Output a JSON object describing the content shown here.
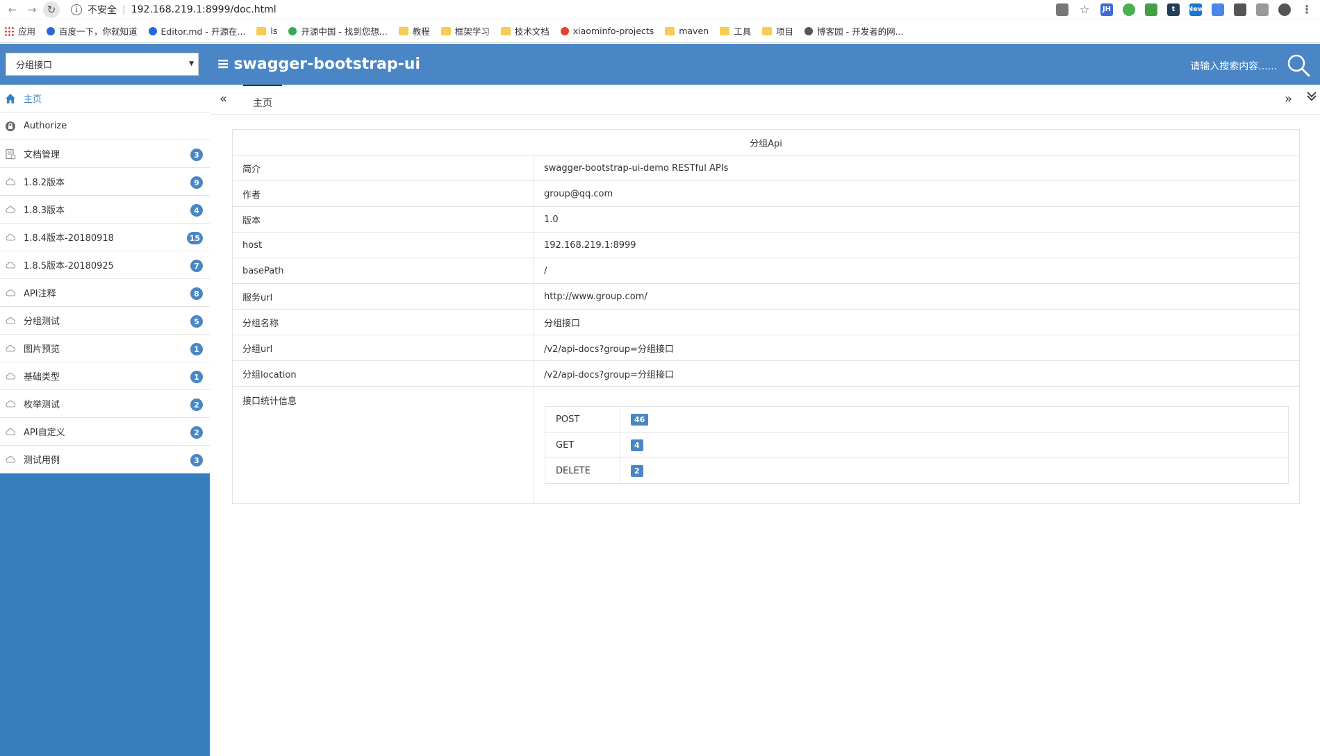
{
  "browser": {
    "insecure_label": "不安全",
    "url": "192.168.219.1:8999/doc.html",
    "extensions": [
      {
        "name": "translate-icon",
        "text": "",
        "color": "#777"
      },
      {
        "name": "star-icon",
        "text": "☆",
        "color": "#555"
      },
      {
        "name": "jh-icon",
        "text": "JH",
        "color": "#3d6bd8"
      },
      {
        "name": "green-circle-icon",
        "text": "",
        "color": "#4caf50"
      },
      {
        "name": "shield-icon",
        "text": "",
        "color": "#43a047"
      },
      {
        "name": "t-icon",
        "text": "t",
        "color": "#243c5a"
      },
      {
        "name": "new-icon",
        "text": "New",
        "color": "#1976d2"
      },
      {
        "name": "translate2-icon",
        "text": "",
        "color": "#4a86e8"
      },
      {
        "name": "puzzle-icon",
        "text": "",
        "color": "#555"
      },
      {
        "name": "window-icon",
        "text": "",
        "color": "#999"
      },
      {
        "name": "account-icon",
        "text": "",
        "color": "#555"
      },
      {
        "name": "more-icon",
        "text": "⋮",
        "color": "#555"
      }
    ]
  },
  "bookmarks": [
    {
      "label": "应用",
      "icon": "apps"
    },
    {
      "label": "百度一下，你就知道",
      "icon": "baidu"
    },
    {
      "label": "Editor.md - 开源在...",
      "icon": "editor"
    },
    {
      "label": "ls",
      "icon": "folder"
    },
    {
      "label": "开源中国 - 找到您想...",
      "icon": "oschina"
    },
    {
      "label": "教程",
      "icon": "folder"
    },
    {
      "label": "框架学习",
      "icon": "folder"
    },
    {
      "label": "技术文档",
      "icon": "folder"
    },
    {
      "label": "xiaominfo-projects",
      "icon": "gitlab"
    },
    {
      "label": "maven",
      "icon": "folder"
    },
    {
      "label": "工具",
      "icon": "folder"
    },
    {
      "label": "项目",
      "icon": "folder"
    },
    {
      "label": "博客园 - 开发者的网...",
      "icon": "cnblogs"
    }
  ],
  "header": {
    "group_select": "分组接口",
    "menu_icon": "≡",
    "title": "swagger-bootstrap-ui",
    "search_placeholder": "请输入搜索内容......"
  },
  "sidebar": {
    "items": [
      {
        "label": "主页",
        "icon": "home",
        "badge": ""
      },
      {
        "label": "Authorize",
        "icon": "lock",
        "badge": ""
      },
      {
        "label": "文档管理",
        "icon": "doc",
        "badge": "3"
      },
      {
        "label": "1.8.2版本",
        "icon": "cloud",
        "badge": "9"
      },
      {
        "label": "1.8.3版本",
        "icon": "cloud",
        "badge": "4"
      },
      {
        "label": "1.8.4版本-20180918",
        "icon": "cloud",
        "badge": "15"
      },
      {
        "label": "1.8.5版本-20180925",
        "icon": "cloud",
        "badge": "7"
      },
      {
        "label": "API注释",
        "icon": "cloud",
        "badge": "8"
      },
      {
        "label": "分组测试",
        "icon": "cloud",
        "badge": "5"
      },
      {
        "label": "图片预览",
        "icon": "cloud",
        "badge": "1"
      },
      {
        "label": "基础类型",
        "icon": "cloud",
        "badge": "1"
      },
      {
        "label": "枚举测试",
        "icon": "cloud",
        "badge": "2"
      },
      {
        "label": "API自定义",
        "icon": "cloud",
        "badge": "2"
      },
      {
        "label": "测试用例",
        "icon": "cloud",
        "badge": "3"
      }
    ]
  },
  "tabs": {
    "prev": "«",
    "home": "主页",
    "next": "»",
    "menu": "⌄"
  },
  "main": {
    "table_title": "分组Api",
    "rows": [
      {
        "key": "简介",
        "value": "swagger-bootstrap-ui-demo RESTful APIs"
      },
      {
        "key": "作者",
        "value": "group@qq.com"
      },
      {
        "key": "版本",
        "value": "1.0"
      },
      {
        "key": "host",
        "value": "192.168.219.1:8999"
      },
      {
        "key": "basePath",
        "value": "/"
      },
      {
        "key": "服务url",
        "value": "http://www.group.com/"
      },
      {
        "key": "分组名称",
        "value": "分组接口"
      },
      {
        "key": "分组url",
        "value": "/v2/api-docs?group=分组接口"
      },
      {
        "key": "分组location",
        "value": "/v2/api-docs?group=分组接口"
      }
    ],
    "stats_label": "接口统计信息",
    "stats": [
      {
        "method": "POST",
        "count": "46"
      },
      {
        "method": "GET",
        "count": "4"
      },
      {
        "method": "DELETE",
        "count": "2"
      }
    ]
  }
}
